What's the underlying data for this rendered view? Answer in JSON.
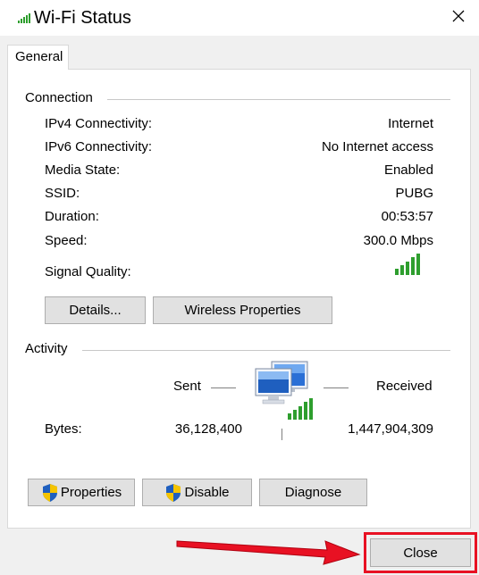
{
  "window": {
    "title": "Wi-Fi Status",
    "close_icon": "close-icon",
    "title_icon": "wifi-signal-icon"
  },
  "tabs": [
    {
      "label": "General"
    }
  ],
  "connection": {
    "heading": "Connection",
    "rows": [
      {
        "label": "IPv4 Connectivity:",
        "value": "Internet"
      },
      {
        "label": "IPv6 Connectivity:",
        "value": "No Internet access"
      },
      {
        "label": "Media State:",
        "value": "Enabled"
      },
      {
        "label": "SSID:",
        "value": "PUBG"
      },
      {
        "label": "Duration:",
        "value": "00:53:57"
      },
      {
        "label": "Speed:",
        "value": "300.0 Mbps"
      }
    ],
    "signal_quality_label": "Signal Quality:",
    "signal_bars": 5,
    "details_button": "Details...",
    "wireless_properties_button": "Wireless Properties"
  },
  "activity": {
    "heading": "Activity",
    "sent_label": "Sent",
    "received_label": "Received",
    "bytes_label": "Bytes:",
    "bytes_sent": "36,128,400",
    "bytes_received": "1,447,904,309"
  },
  "buttons": {
    "properties": "Properties",
    "disable": "Disable",
    "diagnose": "Diagnose",
    "close": "Close"
  },
  "colors": {
    "signal_green": "#2e9e2e",
    "annotation_red": "#e81123",
    "shield_blue": "#1f5fbf",
    "shield_yellow": "#f5c400"
  }
}
